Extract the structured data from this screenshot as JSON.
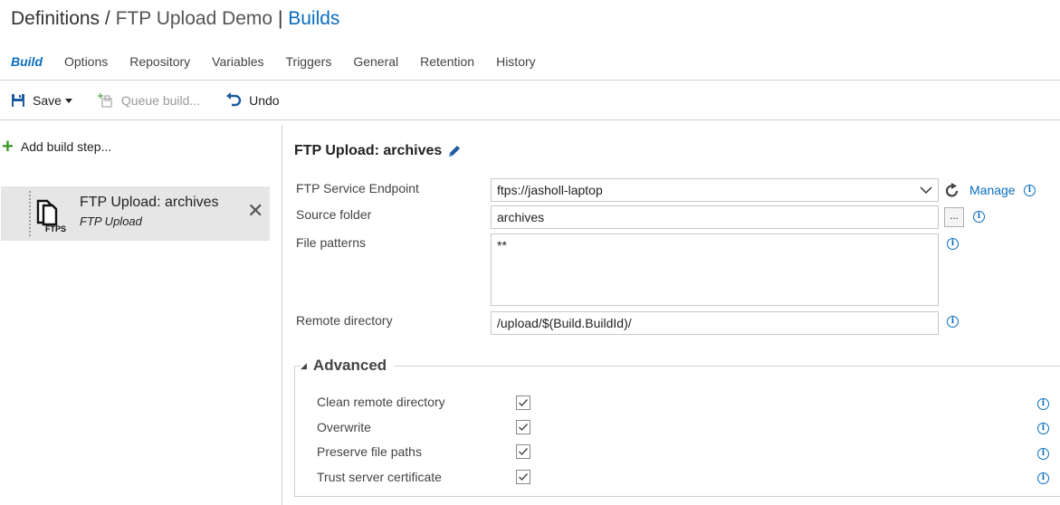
{
  "header": {
    "part1": "Definitions",
    "sep1": " / ",
    "part2": "FTP Upload Demo",
    "sep2": " | ",
    "part3": "Builds"
  },
  "tabs": [
    {
      "label": "Build"
    },
    {
      "label": "Options"
    },
    {
      "label": "Repository"
    },
    {
      "label": "Variables"
    },
    {
      "label": "Triggers"
    },
    {
      "label": "General"
    },
    {
      "label": "Retention"
    },
    {
      "label": "History"
    }
  ],
  "toolbar": {
    "save": "Save",
    "queue": "Queue build...",
    "undo": "Undo"
  },
  "sidebar": {
    "add_step": "Add build step...",
    "step_title": "FTP Upload: archives",
    "step_subtitle": "FTP Upload",
    "step_icon_text": "FTPS"
  },
  "panel": {
    "title": "FTP Upload: archives",
    "endpoint_label": "FTP Service Endpoint",
    "endpoint_value": "ftps://jasholl-laptop",
    "manage": "Manage",
    "source_label": "Source folder",
    "source_value": "archives",
    "browse": "...",
    "patterns_label": "File patterns",
    "patterns_value": "**",
    "remote_label": "Remote directory",
    "remote_value": "/upload/$(Build.BuildId)/"
  },
  "advanced": {
    "title": "Advanced",
    "options": [
      {
        "label": "Clean remote directory",
        "checked": true
      },
      {
        "label": "Overwrite",
        "checked": true
      },
      {
        "label": "Preserve file paths",
        "checked": true
      },
      {
        "label": "Trust server certificate",
        "checked": true
      }
    ]
  },
  "colors": {
    "accent": "#0a6ebd",
    "add_green": "#3c9a27",
    "selected_bg": "#e6e6e6"
  }
}
